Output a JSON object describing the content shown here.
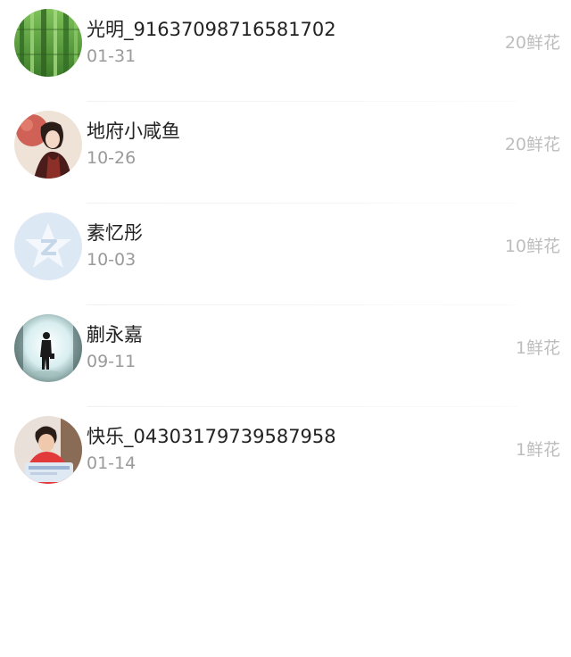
{
  "list": {
    "items": [
      {
        "name": "光明_91637098716581702",
        "date": "01-31",
        "gift": "20鲜花",
        "avatar": "bamboo-forest"
      },
      {
        "name": "地府小咸鱼",
        "date": "10-26",
        "gift": "20鲜花",
        "avatar": "illustrated-character"
      },
      {
        "name": "素忆彤",
        "date": "10-03",
        "gift": "10鲜花",
        "avatar": "default-qq-avatar"
      },
      {
        "name": "蒯永嘉",
        "date": "09-11",
        "gift": "1鲜花",
        "avatar": "silhouette-in-tunnel"
      },
      {
        "name": "快乐_04303179739587958",
        "date": "01-14",
        "gift": "1鲜花",
        "avatar": "child-photo"
      }
    ]
  },
  "colors": {
    "name_text": "#222222",
    "date_text": "#9a9a9a",
    "gift_text": "#bdbdbd",
    "divider": "#f1f1f1",
    "background": "#ffffff"
  }
}
